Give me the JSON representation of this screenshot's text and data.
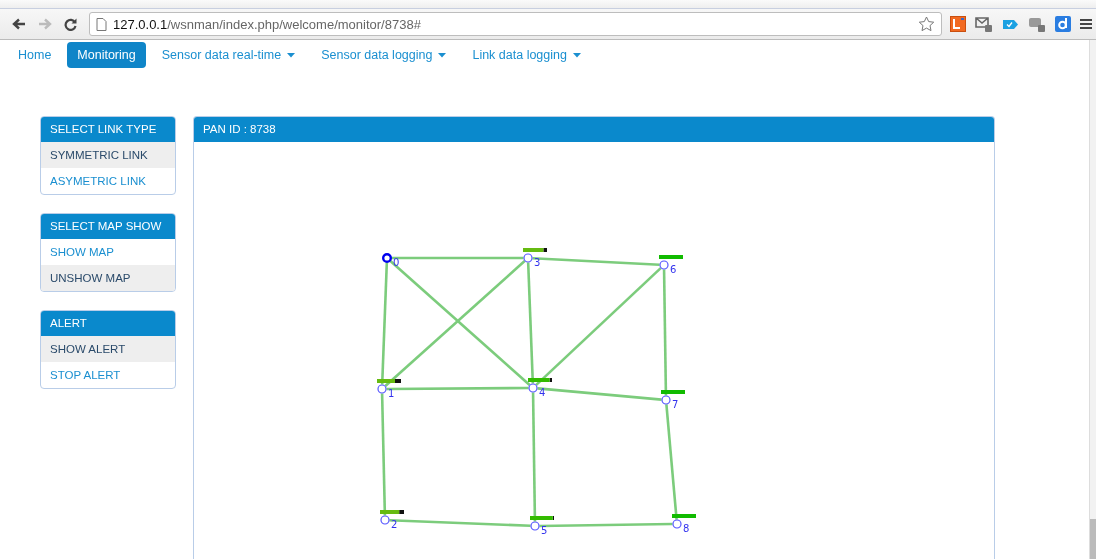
{
  "browser": {
    "url_host": "127.0.0.1",
    "url_path": "/wsnman/index.php/welcome/monitor/8738#"
  },
  "nav": [
    {
      "label": "Home",
      "selected": false,
      "dropdown": false
    },
    {
      "label": "Monitoring",
      "selected": true,
      "dropdown": false
    },
    {
      "label": "Sensor data real-time",
      "selected": false,
      "dropdown": true
    },
    {
      "label": "Sensor data logging",
      "selected": false,
      "dropdown": true
    },
    {
      "label": "Link data logging",
      "selected": false,
      "dropdown": true
    }
  ],
  "sidebar": [
    {
      "title": "SELECT LINK TYPE",
      "items": [
        {
          "label": "SYMMETRIC LINK",
          "selected": true
        },
        {
          "label": "ASYMETRIC LINK",
          "selected": false
        }
      ]
    },
    {
      "title": "SELECT MAP SHOW",
      "items": [
        {
          "label": "SHOW MAP",
          "selected": false
        },
        {
          "label": "UNSHOW MAP",
          "selected": true
        }
      ]
    },
    {
      "title": "ALERT",
      "items": [
        {
          "label": "SHOW ALERT",
          "selected": true
        },
        {
          "label": "STOP ALERT",
          "selected": false
        }
      ]
    }
  ],
  "map_panel": {
    "title": "PAN ID : 8738",
    "nodes": [
      {
        "label": "0",
        "kind": "sink"
      },
      {
        "label": "1",
        "kind": "sensor",
        "level": 0.75
      },
      {
        "label": "2",
        "kind": "sensor",
        "level": 0.8
      },
      {
        "label": "3",
        "kind": "sensor",
        "level": 0.85
      },
      {
        "label": "4",
        "kind": "sensor",
        "level": 0.9
      },
      {
        "label": "5",
        "kind": "sensor",
        "level": 0.95
      },
      {
        "label": "6",
        "kind": "sensor",
        "level": 1
      },
      {
        "label": "7",
        "kind": "sensor",
        "level": 1
      },
      {
        "label": "8",
        "kind": "sensor",
        "level": 1
      }
    ]
  }
}
